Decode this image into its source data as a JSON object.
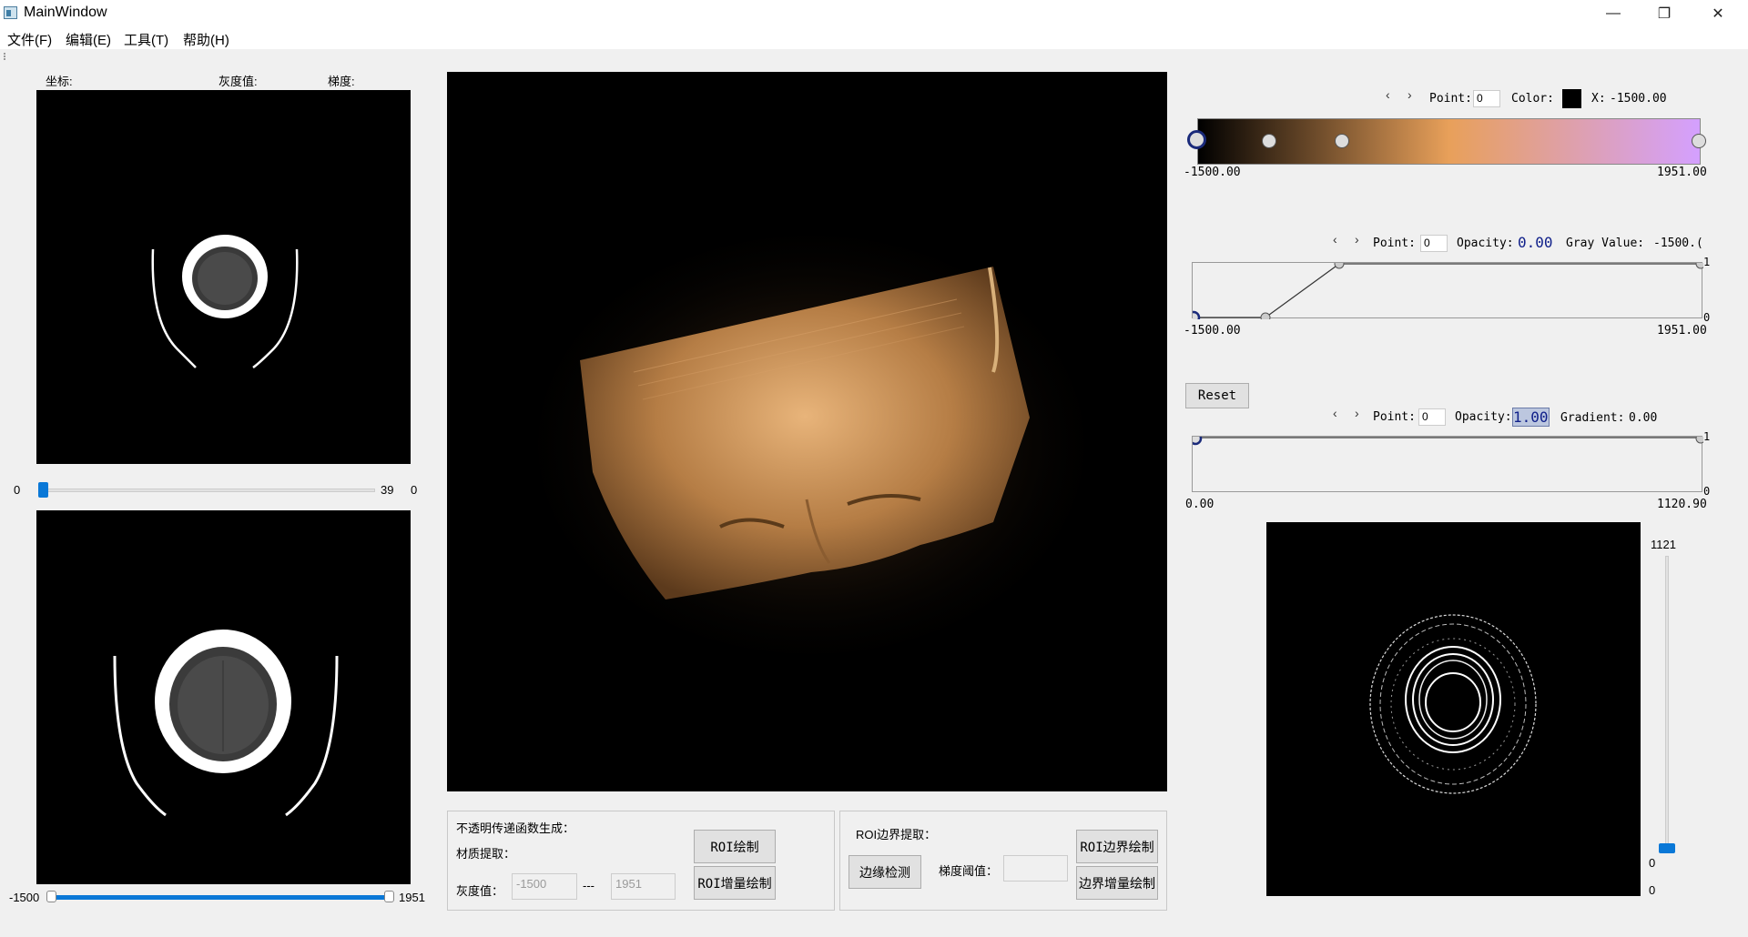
{
  "window": {
    "title": "MainWindow",
    "minimize": "—",
    "maximize": "❐",
    "close": "✕"
  },
  "menu": [
    "文件(F)",
    "编辑(E)",
    "工具(T)",
    "帮助(H)"
  ],
  "info": {
    "coord_label": "坐标:",
    "gray_label": "灰度值:",
    "gradient_label": "梯度:"
  },
  "slice_slider": {
    "min": "0",
    "max": "39",
    "value": "0",
    "fraction": 0.0
  },
  "range_slider": {
    "min": "-1500",
    "max": "1951",
    "low_fraction": 0.0,
    "high_fraction": 1.0
  },
  "opacity_panel": {
    "title": "不透明传递函数生成：",
    "material_label": "材质提取：",
    "gray_label": "灰度值：",
    "low_placeholder": "-1500",
    "separator": "---",
    "high_placeholder": "1951",
    "roi_draw": "ROI绘制",
    "roi_inc_draw": "ROI增量绘制"
  },
  "boundary_panel": {
    "title": "ROI边界提取：",
    "edge_detect": "边缘检测",
    "grad_threshold_label": "梯度阈值：",
    "roi_boundary_draw": "ROI边界绘制",
    "boundary_inc_draw": "边界增量绘制"
  },
  "color_tf": {
    "prev": "‹",
    "next": "›",
    "point_label": "Point:",
    "point_value": "0",
    "color_label": "Color:",
    "color_value": "#000000",
    "x_label": "X:",
    "x_value": "-1500.00",
    "min": "-1500.00",
    "max": "1951.00",
    "stops": [
      "#000000",
      "#e8a05a",
      "#d4a0ff"
    ]
  },
  "scalar_tf": {
    "prev": "‹",
    "next": "›",
    "point_label": "Point:",
    "point_value": "0",
    "opacity_label": "Opacity:",
    "opacity_value": "0.00",
    "gray_label": "Gray Value:",
    "gray_value": "-1500.(",
    "min": "-1500.00",
    "max": "1951.00",
    "y_top": "1",
    "y_bottom": "0"
  },
  "reset_label": "Reset",
  "gradient_tf": {
    "prev": "‹",
    "next": "›",
    "point_label": "Point:",
    "point_value": "0",
    "opacity_label": "Opacity:",
    "opacity_value": "1.00",
    "gradient_label": "Gradient:",
    "gradient_value": "0.00",
    "min": "0.00",
    "max": "1120.90",
    "y_top": "1",
    "y_bottom": "0"
  },
  "grad_slider": {
    "max": "1121",
    "min": "0",
    "value": "0",
    "fraction": 0.0
  }
}
